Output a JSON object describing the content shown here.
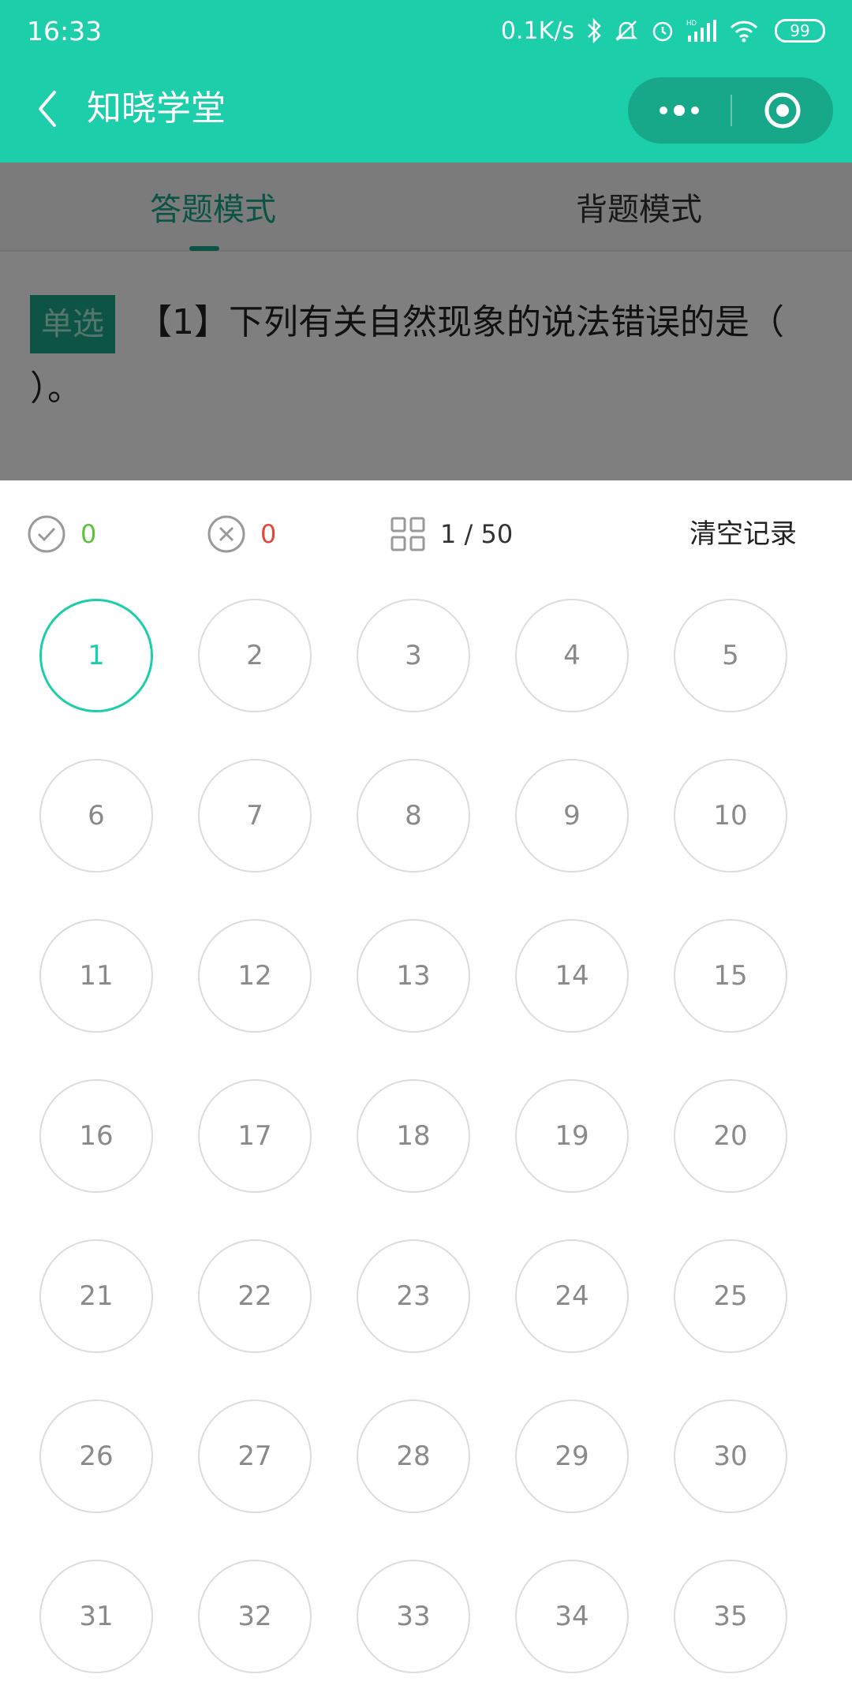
{
  "status_bar": {
    "time": "16:33",
    "network_speed": "0.1K/s",
    "battery": "99"
  },
  "nav": {
    "title": "知晓学堂"
  },
  "tabs": [
    {
      "label": "答题模式",
      "active": true
    },
    {
      "label": "背题模式",
      "active": false
    }
  ],
  "question": {
    "type_badge": "单选",
    "text": "【1】下列有关自然现象的说法错误的是（ ）。"
  },
  "answer_sheet": {
    "correct_count": "0",
    "wrong_count": "0",
    "progress": "1 / 50",
    "clear_label": "清空记录",
    "current": 1,
    "numbers": [
      "1",
      "2",
      "3",
      "4",
      "5",
      "6",
      "7",
      "8",
      "9",
      "10",
      "11",
      "12",
      "13",
      "14",
      "15",
      "16",
      "17",
      "18",
      "19",
      "20",
      "21",
      "22",
      "23",
      "24",
      "25",
      "26",
      "27",
      "28",
      "29",
      "30",
      "31",
      "32",
      "33",
      "34",
      "35"
    ]
  },
  "colors": {
    "accent": "#1dceab",
    "accent_dark": "#17a88a",
    "correct": "#5cc33a",
    "wrong": "#e2463c"
  }
}
